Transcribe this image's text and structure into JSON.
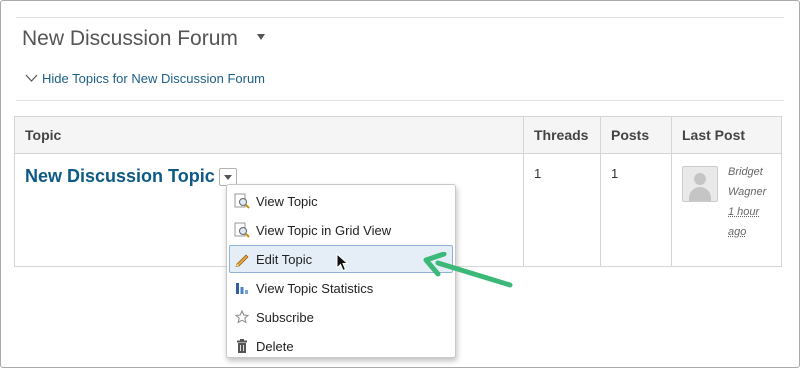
{
  "forum": {
    "title": "New Discussion Forum",
    "hide_topics_label": "Hide Topics for New Discussion Forum"
  },
  "table": {
    "headers": {
      "topic": "Topic",
      "threads": "Threads",
      "posts": "Posts",
      "last_post": "Last Post"
    },
    "row": {
      "topic": "New Discussion Topic",
      "threads": "1",
      "posts": "1",
      "last_post": {
        "author_first": "Bridget",
        "author_last": "Wagner",
        "ago_line1": "1 hour",
        "ago_line2": "ago"
      }
    }
  },
  "context_menu": {
    "items": [
      {
        "label": "View Topic",
        "icon": "magnifier-page-icon"
      },
      {
        "label": "View Topic in Grid View",
        "icon": "magnifier-page-icon"
      },
      {
        "label": "Edit Topic",
        "icon": "pencil-icon",
        "active": true
      },
      {
        "label": "View Topic Statistics",
        "icon": "bar-chart-icon"
      },
      {
        "label": "Subscribe",
        "icon": "star-icon"
      },
      {
        "label": "Delete",
        "icon": "trash-icon"
      }
    ]
  },
  "colors": {
    "link": "#0e5a87",
    "menu_highlight": "#e5eef7",
    "annotation_arrow": "#3cb878"
  }
}
